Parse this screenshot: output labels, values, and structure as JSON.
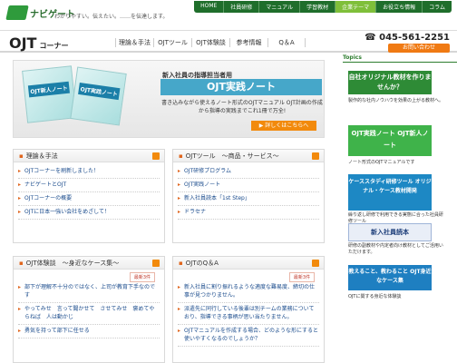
{
  "header": {
    "logo_text": "ナビゲート",
    "tagline": "わかりやすい。伝えたい。……を伝達します。",
    "nav": [
      "HOME",
      "社員研修",
      "マニュアル",
      "学習教材",
      "企業テーマ",
      "お役立ち情報",
      "コラム"
    ],
    "nav_active_index": 4
  },
  "section": {
    "title": "OJT",
    "title_suffix": "コーナー",
    "nav": [
      "理論＆手法",
      "OJTツール",
      "OJT体験談",
      "参考情報",
      "Q＆A"
    ],
    "phone": "045-561-2251",
    "contact_label": "お問い合わせ"
  },
  "hero": {
    "book1_label": "OJT新人ノート",
    "book2_label": "OJT実践ノート",
    "subtitle": "新入社員の指導担当者用",
    "title": "OJT実践ノート",
    "description": "書き込みながら使えるノート形式のOJTマニュアル OJT計画の作成から指導の実践までこれ1冊で万全!",
    "button": "詳しくはこちらへ"
  },
  "boxes": {
    "theory": {
      "title": "理論＆手法",
      "items": [
        "OJTコーナーを刷新しました！",
        "ナビゲートとOJT",
        "OJTコーナーの概要",
        "OJTに日本一強い会社をめざして！"
      ]
    },
    "tools": {
      "title": "OJTツール　～商品・サービス～",
      "items": [
        "OJT研修プログラム",
        "OJT実践ノート",
        "新入社員読本「1st Step」",
        "ドラセナ"
      ]
    },
    "cases": {
      "title": "OJT体験談　～身近なケース集～",
      "badge": "最新3件",
      "items": [
        "部下が理解不十分のではなく、上司が教育下手なのです",
        "やってみせ　言って聞かせて　させてみせ　褒めてやらねば　人は動かじ",
        "勇気を持って部下に任せる"
      ]
    },
    "qa": {
      "title": "OJTのQ＆A",
      "badge": "最新3件",
      "items": [
        "新入社員に割り振れるような適度な難易度、締切の仕事が見つかりません。",
        "派遣先に同行している後輩は別チームの業務についており、指導できる事柄が思い当たりません。",
        "OJTマニュアルを作成する場合、どのような形にすると使いやすくなるのでしょうか？"
      ]
    }
  },
  "sidebar": {
    "heading": "Topics",
    "banners": [
      {
        "label": "自社オリジナル教材を作りませんか？",
        "caption": "製作的な社内ノウハウを効果の上がる教材へ。"
      },
      {
        "label": "OJT実践ノート OJT新人ノート",
        "caption": "ノート形式のOJTマニュアルです"
      },
      {
        "label": "ケーススタディ研修ツール オリジナル・ケース教材開発",
        "caption": "繰り返し研修で利用できる実態に合った社員研修ツール"
      },
      {
        "label": "新入社員読本",
        "caption": "研修の副教材や内定者向け教材としてご活用いただけます。"
      },
      {
        "label": "教えること、教わること OJT身近なケース集",
        "caption": "OJTに関する身近な体験談"
      }
    ]
  },
  "colors": {
    "brand_green": "#2f9b3c",
    "accent_orange": "#f28a0c",
    "hero_blue": "#46a7c9"
  }
}
